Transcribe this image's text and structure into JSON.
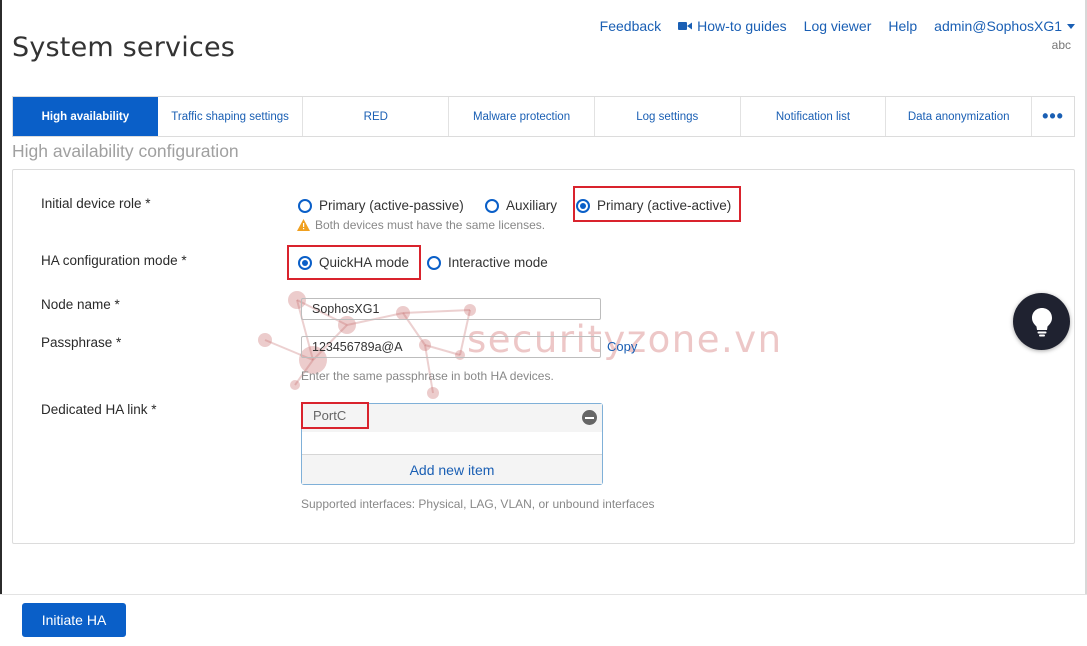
{
  "header": {
    "title": "System services",
    "nav": [
      "Feedback",
      "How-to guides",
      "Log viewer",
      "Help",
      "admin@SophosXG1"
    ],
    "sub_user": "abc"
  },
  "tabs": [
    "High availability",
    "Traffic shaping settings",
    "RED",
    "Malware protection",
    "Log settings",
    "Notification list",
    "Data anonymization",
    "•••"
  ],
  "section_title": "High availability configuration",
  "form": {
    "initial_role": {
      "label": "Initial device role *",
      "options": [
        "Primary (active-passive)",
        "Auxiliary",
        "Primary (active-active)"
      ],
      "selected": "Primary (active-active)",
      "hint": "Both devices must have the same licenses."
    },
    "ha_mode": {
      "label": "HA configuration mode *",
      "options": [
        "QuickHA mode",
        "Interactive mode"
      ],
      "selected": "QuickHA mode"
    },
    "node_name": {
      "label": "Node name *",
      "value": "SophosXG1"
    },
    "passphrase": {
      "label": "Passphrase *",
      "value": "123456789a@A",
      "copy_label": "Copy",
      "hint": "Enter the same passphrase in both HA devices."
    },
    "ha_link": {
      "label": "Dedicated HA link *",
      "items": [
        "PortC"
      ],
      "add_label": "Add new item",
      "hint": "Supported interfaces: Physical, LAG, VLAN, or unbound interfaces"
    }
  },
  "watermark": "securityzone.vn",
  "footer": {
    "initiate_label": "Initiate HA"
  },
  "colors": {
    "accent": "#0a5fc8",
    "highlight": "#d9232d"
  }
}
